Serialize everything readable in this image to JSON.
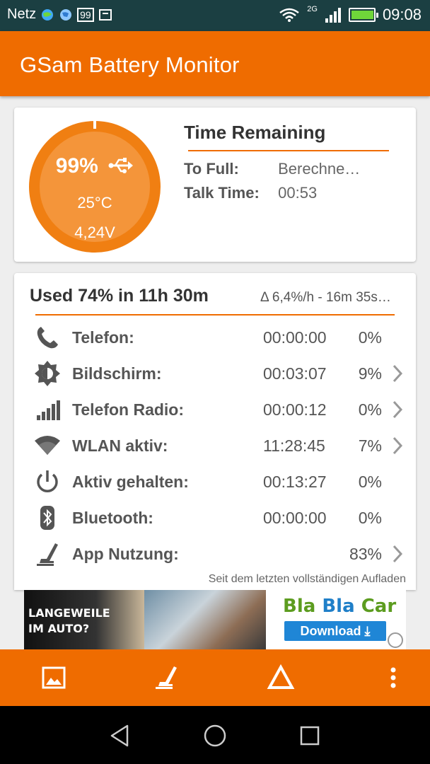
{
  "status_bar": {
    "carrier": "Netz",
    "notification_badge": "99",
    "network": "2G",
    "time": "09:08"
  },
  "app_bar": {
    "title": "GSam Battery Monitor"
  },
  "battery_card": {
    "percent": "99%",
    "level_fraction": 0.99,
    "temperature": "25°C",
    "voltage": "4,24V",
    "time_remaining_title": "Time Remaining",
    "to_full_label": "To Full:",
    "to_full_value": "Berechne…",
    "talk_time_label": "Talk Time:",
    "talk_time_value": "00:53"
  },
  "usage_card": {
    "title": "Used 74% in 11h 30m",
    "rate": "Δ 6,4%/h - 16m 35s…",
    "rows": [
      {
        "icon": "phone-icon",
        "label": "Telefon:",
        "time": "00:00:00",
        "pct": "0%",
        "chevron": false
      },
      {
        "icon": "screen-brightness-icon",
        "label": "Bildschirm:",
        "time": "00:03:07",
        "pct": "9%",
        "chevron": true
      },
      {
        "icon": "signal-bars-icon",
        "label": "Telefon Radio:",
        "time": "00:00:12",
        "pct": "0%",
        "chevron": true
      },
      {
        "icon": "wifi-icon",
        "label": "WLAN aktiv:",
        "time": "11:28:45",
        "pct": "7%",
        "chevron": true
      },
      {
        "icon": "power-icon",
        "label": "Aktiv gehalten:",
        "time": "00:13:27",
        "pct": "0%",
        "chevron": false
      },
      {
        "icon": "bluetooth-icon",
        "label": "Bluetooth:",
        "time": "00:00:00",
        "pct": "0%",
        "chevron": false
      },
      {
        "icon": "app-usage-icon",
        "label": "App Nutzung:",
        "time": "",
        "pct": "83%",
        "chevron": true
      }
    ],
    "footnote": "Seit dem letzten vollständigen Aufladen"
  },
  "ad": {
    "left_text_line1": "LANGEWEILE",
    "left_text_line2": "IM AUTO?",
    "brand_part1": "Bla",
    "brand_part2": "Bla",
    "brand_part3": "Car",
    "download_label": "Download ⤓"
  },
  "toolbar": {
    "items": [
      "image-icon",
      "app-usage-icon",
      "delta-icon",
      "overflow-menu-icon"
    ]
  },
  "colors": {
    "accent": "#ef6c00",
    "status_bar": "#1b3f42",
    "gauge_outer": "#f07f12",
    "gauge_inner": "#f4953a"
  }
}
